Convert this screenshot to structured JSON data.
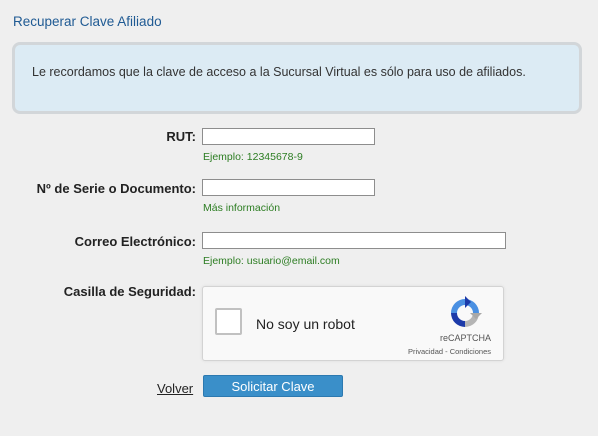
{
  "page": {
    "title": "Recuperar Clave Afiliado"
  },
  "notice": {
    "text": "Le recordamos que la clave de acceso a la Sucursal Virtual es sólo para uso de afiliados."
  },
  "form": {
    "rut": {
      "label": "RUT:",
      "value": "",
      "hint": "Ejemplo: 12345678-9"
    },
    "serie": {
      "label": "Nº de Serie o Documento:",
      "value": "",
      "hint": "Más información"
    },
    "email": {
      "label": "Correo Electrónico:",
      "value": "",
      "hint": "Ejemplo: usuario@email.com"
    },
    "security": {
      "label": "Casilla de Seguridad:"
    }
  },
  "captcha": {
    "checkbox_label": "No soy un robot",
    "brand": "reCAPTCHA",
    "terms": "Privacidad - Condiciones",
    "checked": false
  },
  "actions": {
    "back_label": "Volver",
    "submit_label": "Solicitar Clave"
  },
  "colors": {
    "title": "#1f5a93",
    "notice_bg": "#dcebf4",
    "hint": "#2c7d22",
    "submit_bg": "#3a8fc9"
  }
}
